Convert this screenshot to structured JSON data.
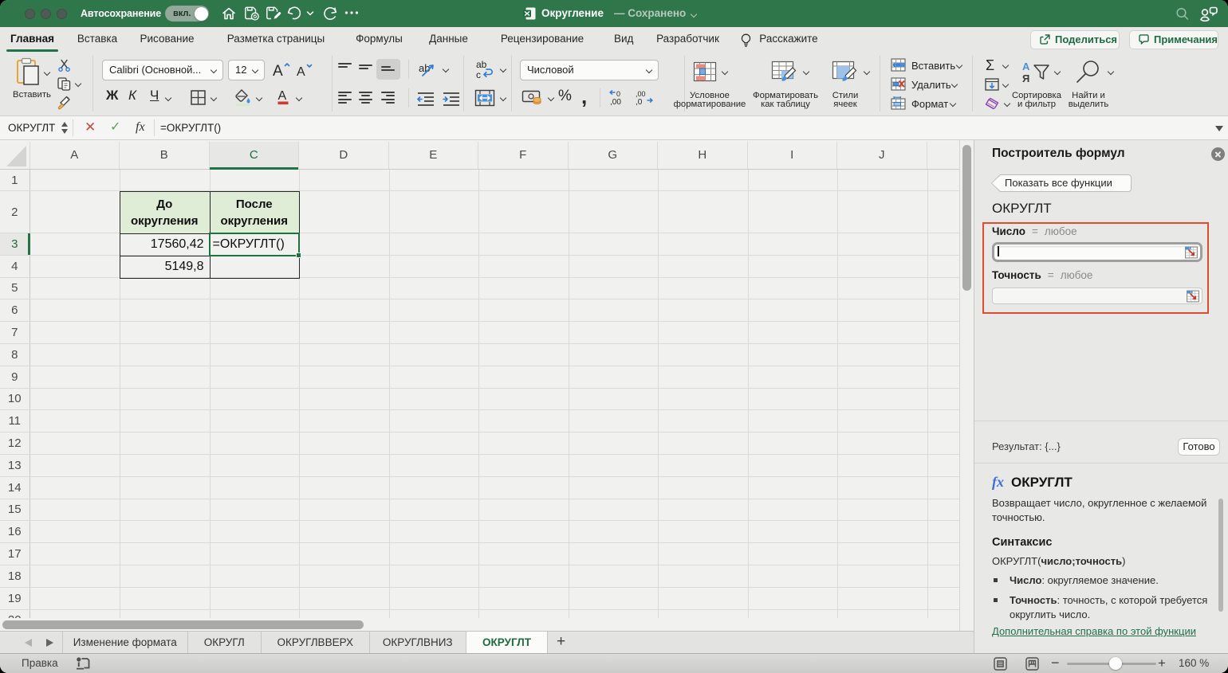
{
  "titlebar": {
    "autosave_label": "Автосохранение",
    "autosave_state": "вкл.",
    "doc_title": "Округление",
    "doc_status": "— Сохранено"
  },
  "ribbon_tabs": [
    {
      "label": "Главная",
      "active": true
    },
    {
      "label": "Вставка"
    },
    {
      "label": "Рисование"
    },
    {
      "label": "Разметка страницы"
    },
    {
      "label": "Формулы"
    },
    {
      "label": "Данные"
    },
    {
      "label": "Рецензирование"
    },
    {
      "label": "Вид"
    },
    {
      "label": "Разработчик"
    },
    {
      "label": "Расскажите",
      "bulb": true
    }
  ],
  "chrome_buttons": {
    "share": "Поделиться",
    "comments": "Примечания"
  },
  "ribbon": {
    "paste": "Вставить",
    "font_name": "Calibri (Основной...",
    "font_size": "12",
    "bold": "Ж",
    "italic": "К",
    "underline": "Ч",
    "number_format": "Числовой",
    "percent": "%",
    "comma": ",",
    "cond_format": "Условное\nформатирование",
    "format_table": "Форматировать\nкак таблицу",
    "cell_styles": "Стили\nячеек",
    "insert": "Вставить",
    "delete": "Удалить",
    "format": "Формат",
    "sigma": "Σ",
    "sort_filter": "Сортировка\nи фильтр",
    "find_select": "Найти и\nвыделить"
  },
  "formula_bar": {
    "name_box": "ОКРУГЛТ",
    "cancel": "✕",
    "confirm": "✓",
    "fx": "fx",
    "formula": "=ОКРУГЛТ()"
  },
  "sheet": {
    "columns": [
      "A",
      "B",
      "C",
      "D",
      "E",
      "F",
      "G",
      "H",
      "I",
      "J",
      ""
    ],
    "selected_column": "C",
    "row_count": 20,
    "selected_row": 3,
    "cells": {
      "B2": "До округления",
      "C2": "После округления",
      "B3": "17560,42",
      "C3": "=ОКРУГЛТ()",
      "B4": "5149,8",
      "C4": ""
    },
    "active_cell": "C3"
  },
  "panel": {
    "title": "Построитель формул",
    "show_all": "Показать все функции",
    "function_name": "ОКРУГЛТ",
    "arg1_name": "Число",
    "arg1_eq": "=",
    "arg1_hint": "любое",
    "arg2_name": "Точность",
    "arg2_eq": "=",
    "arg2_hint": "любое",
    "result_label": "Результат: {...}",
    "done": "Готово",
    "fx": "fx",
    "doc_fn": "ОКРУГЛТ",
    "description": "Возвращает число, округленное с желаемой точностью.",
    "syntax_heading": "Синтаксис",
    "syntax_pre": "ОКРУГЛТ(",
    "syntax_args": "число;точность",
    "syntax_post": ")",
    "bullet1_term": "Число",
    "bullet1_rest": ": округляемое значение.",
    "bullet2_term": "Точность",
    "bullet2_rest": ": точность, с которой требуется округлить число.",
    "link": "Дополнительная справка по этой функции"
  },
  "sheet_tabs": {
    "tabs": [
      "Изменение формата",
      "ОКРУГЛ",
      "ОКРУГЛВВЕРХ",
      "ОКРУГЛВНИЗ",
      "ОКРУГЛТ"
    ],
    "active": "ОКРУГЛТ",
    "add": "+"
  },
  "status_bar": {
    "mode": "Правка",
    "zoom": "160 %",
    "zoom_out": "−",
    "zoom_in": "+"
  },
  "colors": {
    "titlebar_green": "#30764b",
    "accent_green": "#217346",
    "table_header_fill": "#dfecd6",
    "annotation_red": "#e2492f",
    "link_green": "#21704a"
  }
}
